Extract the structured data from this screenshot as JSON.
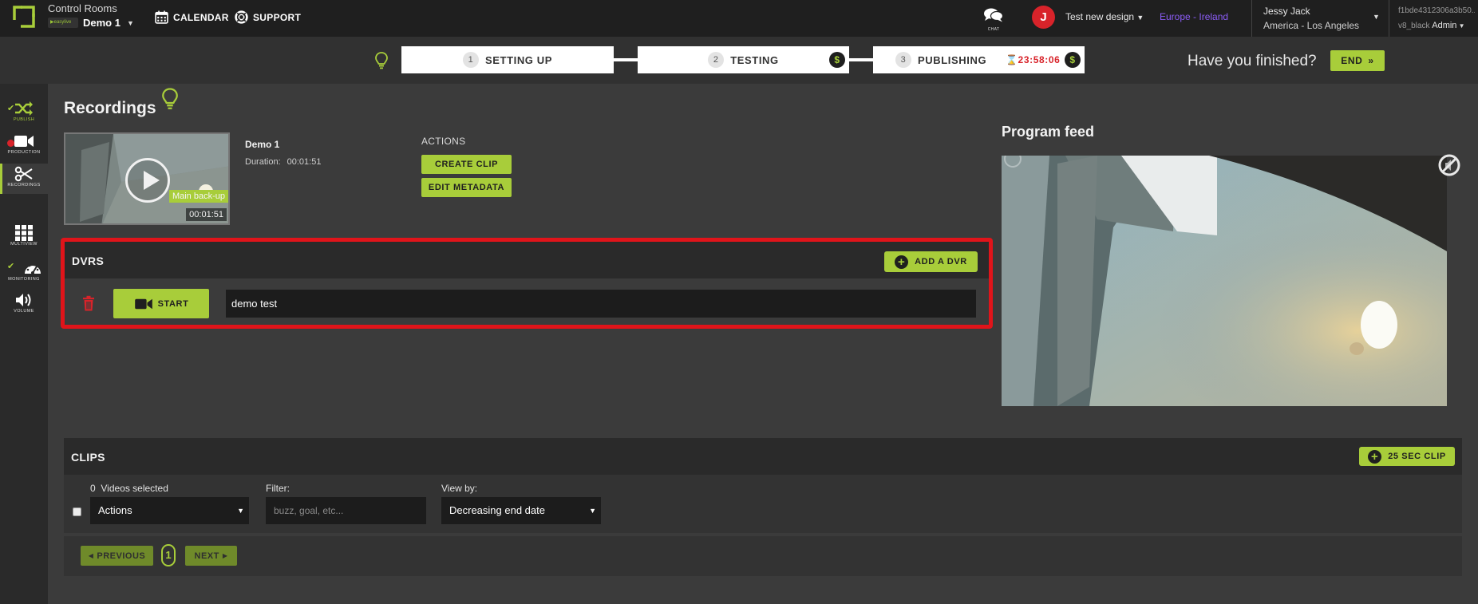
{
  "header": {
    "app_title": "Control Rooms",
    "room_name": "Demo 1",
    "nav": [
      {
        "label": "CALENDAR",
        "icon": "calendar-icon"
      },
      {
        "label": "SUPPORT",
        "icon": "lifebuoy-icon"
      }
    ],
    "chat_label": "CHAT",
    "avatar_initial": "J",
    "design_label": "Test new design",
    "region": "Europe - Ireland",
    "user_name": "Jessy Jack",
    "user_timezone": "America - Los Angeles",
    "account_id": "f1bde4312306a3b50...",
    "account_name": "v8_black",
    "account_role": "Admin"
  },
  "steps": [
    {
      "num": "1",
      "label": "SETTING UP"
    },
    {
      "num": "2",
      "label": "TESTING"
    },
    {
      "num": "3",
      "label": "PUBLISHING"
    }
  ],
  "timer": "23:58:06",
  "dollar_symbol": "$",
  "finished_prompt": "Have you finished?",
  "end_label": "END",
  "sidebar": [
    {
      "label": "PUBLISH",
      "icon": "shuffle-icon"
    },
    {
      "label": "PRODUCTION",
      "icon": "video-camera-icon"
    },
    {
      "label": "RECORDINGS",
      "icon": "scissors-icon"
    },
    {
      "label": "MULTIVIEW",
      "icon": "grid-icon"
    },
    {
      "label": "MONITORING",
      "icon": "gauge-icon"
    },
    {
      "label": "VOLUME",
      "icon": "speaker-icon"
    }
  ],
  "recordings": {
    "title": "Recordings",
    "item": {
      "name": "Demo 1",
      "duration_label": "Duration:",
      "duration": "00:01:51",
      "thumb_tag": "Main back-up",
      "thumb_duration": "00:01:51"
    },
    "actions_heading": "ACTIONS",
    "actions": [
      "CREATE CLIP",
      "EDIT METADATA"
    ]
  },
  "dvrs": {
    "title": "DVRS",
    "add_label": "ADD A DVR",
    "start_label": "START",
    "name_value": "demo test"
  },
  "program_feed": {
    "title": "Program feed"
  },
  "clips": {
    "title": "CLIPS",
    "add_label": "25 SEC CLIP",
    "selected_count": "0",
    "selected_label": "Videos selected",
    "actions_value": "Actions",
    "filter_label": "Filter:",
    "filter_placeholder": "buzz, goal, etc...",
    "viewby_label": "View by:",
    "viewby_value": "Decreasing end date"
  },
  "pagination": {
    "previous": "PREVIOUS",
    "page": "1",
    "next": "NEXT"
  },
  "colors": {
    "accent": "#a8cd3a",
    "danger": "#e0141a",
    "region": "#8b5cf6",
    "bg": "#3b3b3b",
    "topbar": "#1f1f1f"
  }
}
